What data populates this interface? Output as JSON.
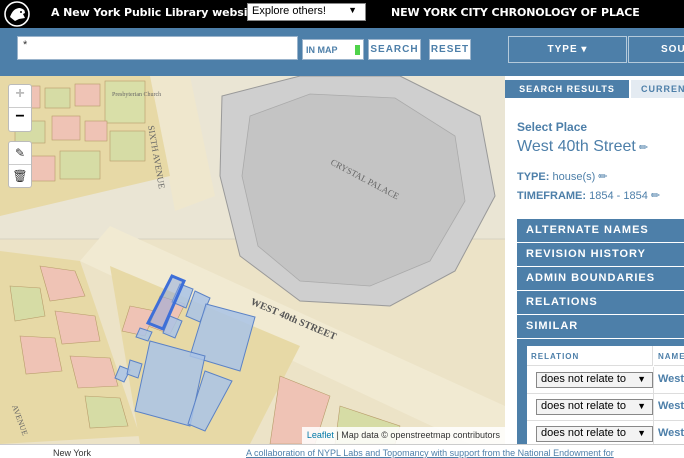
{
  "header": {
    "nypl_link": "A New York Public Library website",
    "explore_select": "Explore others!",
    "site_title": "NEW YORK CITY CHRONOLOGY OF PLACE"
  },
  "search": {
    "query_value": "*",
    "in_map_label": "IN MAP",
    "search_button": "SEARCH",
    "reset_button": "RESET",
    "facets": [
      "TYPE ▾",
      "SOURCE"
    ]
  },
  "map": {
    "zoom_in": "+",
    "zoom_out": "−",
    "attribution_link": "Leaflet",
    "attribution_text": " | Map data © openstreetmap contributors",
    "labels": {
      "crystal_palace": "CRYSTAL PALACE",
      "sixth_avenue": "SIXTH AVENUE",
      "west_40th": "WEST 40th STREET",
      "presbyterian": "Presbyterian Church",
      "avenue_fragment": "AVENUE"
    }
  },
  "panel": {
    "tabs": [
      "SEARCH RESULTS",
      "CURRENT"
    ],
    "select_place": "Select Place",
    "place_name": "West 40th Street",
    "type_label": "TYPE:",
    "type_value": "house(s)",
    "timeframe_label": "TIMEFRAME:",
    "timeframe_value": "1854 - 1854",
    "sections": [
      "ALTERNATE NAMES",
      "REVISION HISTORY",
      "ADMIN BOUNDARIES",
      "RELATIONS",
      "SIMILAR"
    ],
    "similar_table": {
      "headers": [
        "RELATION",
        "NAME"
      ],
      "rows": [
        {
          "relation": "does not relate to",
          "name": "West"
        },
        {
          "relation": "does not relate to",
          "name": "West"
        },
        {
          "relation": "does not relate to",
          "name": "West"
        }
      ]
    }
  },
  "footer": {
    "left": "New York",
    "right": "A collaboration of NYPL Labs and Topomancy with support from the National Endowment for"
  },
  "colors": {
    "brand_blue": "#4d7fa9",
    "highlight_polygon": "#3e6fd8",
    "toggle_green": "#4fd34a"
  }
}
